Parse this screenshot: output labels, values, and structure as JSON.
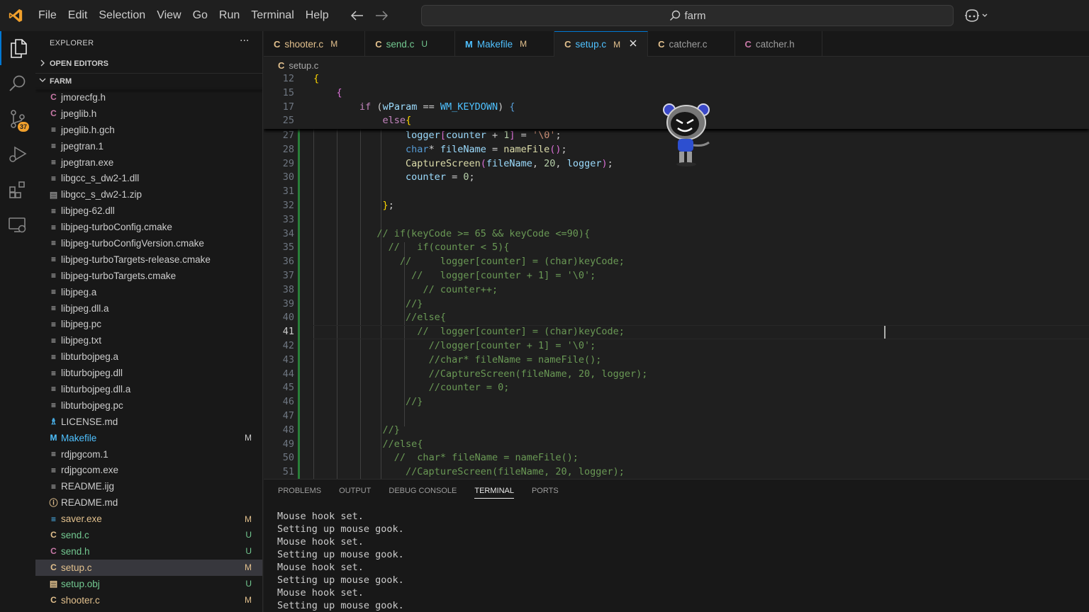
{
  "menu": [
    "File",
    "Edit",
    "Selection",
    "View",
    "Go",
    "Run",
    "Terminal",
    "Help"
  ],
  "search": {
    "text": "farm"
  },
  "activity": {
    "scm_badge": "37"
  },
  "explorer": {
    "title": "EXPLORER",
    "more": "···",
    "open_editors": "OPEN EDITORS",
    "folder": "FARM"
  },
  "files": [
    {
      "icon": "C",
      "icon_color": "#c778a6",
      "name": "jmorecfg.h",
      "status": "",
      "cls": ""
    },
    {
      "icon": "C",
      "icon_color": "#c778a6",
      "name": "jpeglib.h",
      "status": "",
      "cls": ""
    },
    {
      "icon": "≡",
      "icon_color": "#cccccc",
      "name": "jpeglib.h.gch",
      "status": "",
      "cls": ""
    },
    {
      "icon": "≡",
      "icon_color": "#cccccc",
      "name": "jpegtran.1",
      "status": "",
      "cls": ""
    },
    {
      "icon": "≡",
      "icon_color": "#cccccc",
      "name": "jpegtran.exe",
      "status": "",
      "cls": ""
    },
    {
      "icon": "≡",
      "icon_color": "#cccccc",
      "name": "libgcc_s_dw2-1.dll",
      "status": "",
      "cls": ""
    },
    {
      "icon": "▤",
      "icon_color": "#8a8a8a",
      "name": "libgcc_s_dw2-1.zip",
      "status": "",
      "cls": ""
    },
    {
      "icon": "≡",
      "icon_color": "#cccccc",
      "name": "libjpeg-62.dll",
      "status": "",
      "cls": ""
    },
    {
      "icon": "≡",
      "icon_color": "#cccccc",
      "name": "libjpeg-turboConfig.cmake",
      "status": "",
      "cls": ""
    },
    {
      "icon": "≡",
      "icon_color": "#cccccc",
      "name": "libjpeg-turboConfigVersion.cmake",
      "status": "",
      "cls": ""
    },
    {
      "icon": "≡",
      "icon_color": "#cccccc",
      "name": "libjpeg-turboTargets-release.cmake",
      "status": "",
      "cls": ""
    },
    {
      "icon": "≡",
      "icon_color": "#cccccc",
      "name": "libjpeg-turboTargets.cmake",
      "status": "",
      "cls": ""
    },
    {
      "icon": "≡",
      "icon_color": "#cccccc",
      "name": "libjpeg.a",
      "status": "",
      "cls": ""
    },
    {
      "icon": "≡",
      "icon_color": "#cccccc",
      "name": "libjpeg.dll.a",
      "status": "",
      "cls": ""
    },
    {
      "icon": "≡",
      "icon_color": "#cccccc",
      "name": "libjpeg.pc",
      "status": "",
      "cls": ""
    },
    {
      "icon": "≡",
      "icon_color": "#cccccc",
      "name": "libjpeg.txt",
      "status": "",
      "cls": ""
    },
    {
      "icon": "≡",
      "icon_color": "#cccccc",
      "name": "libturbojpeg.a",
      "status": "",
      "cls": ""
    },
    {
      "icon": "≡",
      "icon_color": "#cccccc",
      "name": "libturbojpeg.dll",
      "status": "",
      "cls": ""
    },
    {
      "icon": "≡",
      "icon_color": "#cccccc",
      "name": "libturbojpeg.dll.a",
      "status": "",
      "cls": ""
    },
    {
      "icon": "≡",
      "icon_color": "#cccccc",
      "name": "libturbojpeg.pc",
      "status": "",
      "cls": ""
    },
    {
      "icon": "♗",
      "icon_color": "#4fc1ff",
      "name": "LICENSE.md",
      "status": "",
      "cls": ""
    },
    {
      "icon": "M",
      "icon_color": "#4fc1ff",
      "name": "Makefile",
      "status": "M",
      "cls": "st-Mb"
    },
    {
      "icon": "≡",
      "icon_color": "#cccccc",
      "name": "rdjpgcom.1",
      "status": "",
      "cls": ""
    },
    {
      "icon": "≡",
      "icon_color": "#cccccc",
      "name": "rdjpgcom.exe",
      "status": "",
      "cls": ""
    },
    {
      "icon": "≡",
      "icon_color": "#cccccc",
      "name": "README.ijg",
      "status": "",
      "cls": ""
    },
    {
      "icon": "ⓘ",
      "icon_color": "#e2c08d",
      "name": "README.md",
      "status": "",
      "cls": ""
    },
    {
      "icon": "≡",
      "icon_color": "#4fc1ff",
      "name": "saver.exe",
      "status": "M",
      "cls": "st-M"
    },
    {
      "icon": "C",
      "icon_color": "#e2c08d",
      "name": "send.c",
      "status": "U",
      "cls": "st-U"
    },
    {
      "icon": "C",
      "icon_color": "#c778a6",
      "name": "send.h",
      "status": "U",
      "cls": "st-U"
    },
    {
      "icon": "C",
      "icon_color": "#e2c08d",
      "name": "setup.c",
      "status": "M",
      "cls": "st-M",
      "selected": true
    },
    {
      "icon": "▤",
      "icon_color": "#e2c08d",
      "name": "setup.obj",
      "status": "U",
      "cls": "st-U"
    },
    {
      "icon": "C",
      "icon_color": "#e2c08d",
      "name": "shooter.c",
      "status": "M",
      "cls": "st-M"
    }
  ],
  "tabs": [
    {
      "icon": "C",
      "icon_color": "#e2c08d",
      "label": "shooter.c",
      "status": "M",
      "status_color": "#e2c08d",
      "label_color": "#e2c08d"
    },
    {
      "icon": "C",
      "icon_color": "#e2c08d",
      "label": "send.c",
      "status": "U",
      "status_color": "#73c991",
      "label_color": "#73c991"
    },
    {
      "icon": "M",
      "icon_color": "#4fc1ff",
      "label": "Makefile",
      "status": "M",
      "status_color": "#e2c08d",
      "label_color": "#4fc1ff"
    },
    {
      "icon": "C",
      "icon_color": "#e2c08d",
      "label": "setup.c",
      "status": "M",
      "status_color": "#e2c08d",
      "label_color": "#4fc1ff",
      "active": true
    },
    {
      "icon": "C",
      "icon_color": "#e2c08d",
      "label": "catcher.c",
      "status": "",
      "status_color": "",
      "label_color": "#9d9d9d"
    },
    {
      "icon": "C",
      "icon_color": "#c778a6",
      "label": "catcher.h",
      "status": "",
      "status_color": "",
      "label_color": "#9d9d9d"
    }
  ],
  "breadcrumb": {
    "icon": "C",
    "file": "setup.c"
  },
  "sticky_lines": [
    {
      "n": "12",
      "html": "<span class=\"brace\">{</span>"
    },
    {
      "n": "15",
      "html": "    <span class=\"brace2\">{</span>"
    },
    {
      "n": "17",
      "html": "        <span class=\"kw\">if</span> (<span class=\"var\">wParam</span> == <span class=\"macro\">WM_KEYDOWN</span>) <span class=\"kw2\">{</span>"
    },
    {
      "n": "25",
      "html": "            <span class=\"kw\">else</span><span class=\"brace\">{</span>"
    }
  ],
  "code_lines": [
    {
      "n": "27",
      "html": "                <span class=\"var\">logger</span><span class=\"brace2\">[</span><span class=\"var\">counter</span> + <span class=\"num\">1</span><span class=\"brace2\">]</span> = <span class=\"str\">'\\0'</span>;"
    },
    {
      "n": "28",
      "html": "                <span class=\"kw2\">char</span>* <span class=\"var\">fileName</span> = <span class=\"fn\">nameFile</span><span class=\"brace2\">()</span>;"
    },
    {
      "n": "29",
      "html": "                <span class=\"fn\">CaptureScreen</span><span class=\"brace2\">(</span><span class=\"var\">fileName</span>, <span class=\"num\">20</span>, <span class=\"var\">logger</span><span class=\"brace2\">)</span>;"
    },
    {
      "n": "30",
      "html": "                <span class=\"var\">counter</span> = <span class=\"num\">0</span>;"
    },
    {
      "n": "31",
      "html": ""
    },
    {
      "n": "32",
      "html": "            <span class=\"brace\">}</span>;"
    },
    {
      "n": "33",
      "html": ""
    },
    {
      "n": "34",
      "html": "           <span class=\"cm\">// if(keyCode >= 65 && keyCode <=90){</span>"
    },
    {
      "n": "35",
      "html": "             <span class=\"cm\">//   if(counter < 5){</span>"
    },
    {
      "n": "36",
      "html": "               <span class=\"cm\">//     logger[counter] = (char)keyCode;</span>"
    },
    {
      "n": "37",
      "html": "                 <span class=\"cm\">//   logger[counter + 1] = '\\0';</span>"
    },
    {
      "n": "38",
      "html": "                   <span class=\"cm\">// counter++;</span>"
    },
    {
      "n": "39",
      "html": "                <span class=\"cm\">//}</span>"
    },
    {
      "n": "40",
      "html": "                <span class=\"cm\">//else{</span>"
    },
    {
      "n": "41",
      "html": "                  <span class=\"cm\">//  logger[counter] = (char)keyCode;</span>"
    },
    {
      "n": "42",
      "html": "                    <span class=\"cm\">//logger[counter + 1] = '\\0';</span>"
    },
    {
      "n": "43",
      "html": "                    <span class=\"cm\">//char* fileName = nameFile();</span>"
    },
    {
      "n": "44",
      "html": "                    <span class=\"cm\">//CaptureScreen(fileName, 20, logger);</span>"
    },
    {
      "n": "45",
      "html": "                    <span class=\"cm\">//counter = 0;</span>"
    },
    {
      "n": "46",
      "html": "                <span class=\"cm\">//}</span>"
    },
    {
      "n": "47",
      "html": ""
    },
    {
      "n": "48",
      "html": "            <span class=\"cm\">//}</span>"
    },
    {
      "n": "49",
      "html": "            <span class=\"cm\">//else{</span>"
    },
    {
      "n": "50",
      "html": "              <span class=\"cm\">//  char* fileName = nameFile();</span>"
    },
    {
      "n": "51",
      "html": "                <span class=\"cm\">//CaptureScreen(fileName, 20, logger);</span>"
    }
  ],
  "current_line": "41",
  "panel": {
    "tabs": [
      "PROBLEMS",
      "OUTPUT",
      "DEBUG CONSOLE",
      "TERMINAL",
      "PORTS"
    ],
    "active_tab": "TERMINAL",
    "terminal_lines": [
      "Mouse hook set.",
      "Setting up mouse gook.",
      "Mouse hook set.",
      "Setting up mouse gook.",
      "Mouse hook set.",
      "Setting up mouse gook.",
      "Mouse hook set.",
      "Setting up mouse gook."
    ]
  }
}
